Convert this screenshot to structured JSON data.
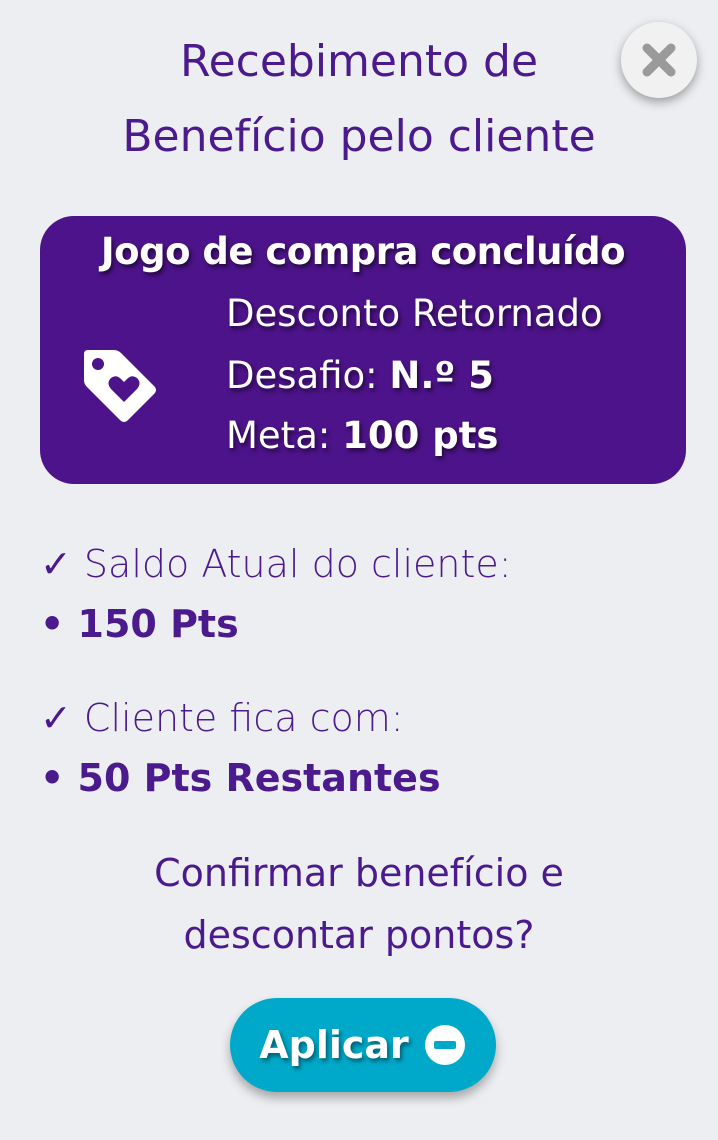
{
  "dialog": {
    "title_line1": "Recebimento de",
    "title_line2": "Benefício pelo cliente"
  },
  "card": {
    "title": "Jogo de compra concluído",
    "reward_type": "Desconto Retornado",
    "challenge_label": "Desafio: ",
    "challenge_value": "N.º 5",
    "goal_label": "Meta: ",
    "goal_value": "100 pts",
    "icon": "tag-heart-icon"
  },
  "balance": {
    "current_label": "✓ Saldo Atual do cliente:",
    "current_value": "• 150 Pts",
    "remaining_label": "✓ Cliente fica com:",
    "remaining_value": "• 50 Pts Restantes"
  },
  "confirm": {
    "question_line1": "Confirmar benefício e",
    "question_line2": "descontar pontos?",
    "apply_label": "Aplicar",
    "apply_icon": "minus-circle-icon",
    "close_icon": "close-icon"
  },
  "colors": {
    "primary": "#4b1a8c",
    "card_bg": "#4d138a",
    "button": "#00a9c9",
    "background": "#eceef1"
  }
}
